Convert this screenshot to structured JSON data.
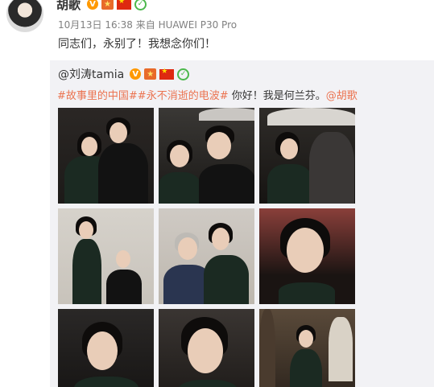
{
  "post": {
    "username": "胡歌",
    "meta": "10月13日 16:38 来自 HUAWEI P30 Pro",
    "text": "同志们，永别了！我想念你们！",
    "badge_v": "V",
    "badge_star": "★"
  },
  "repost": {
    "username": "@刘涛tamia",
    "badge_v": "V",
    "badge_star": "★",
    "hashtag_1": "#故事里的中国#",
    "hashtag_2": "#永不消逝的电波#",
    "body": " 你好！我是何兰芬。",
    "mention": "@胡歌",
    "images": [
      {
        "label": "photo-1"
      },
      {
        "label": "photo-2"
      },
      {
        "label": "photo-3"
      },
      {
        "label": "photo-4"
      },
      {
        "label": "photo-5"
      },
      {
        "label": "photo-6"
      },
      {
        "label": "photo-7"
      },
      {
        "label": "photo-8"
      },
      {
        "label": "photo-9"
      }
    ]
  },
  "colors": {
    "link": "#eb7350",
    "meta": "#808080",
    "repost_bg": "#f2f2f5",
    "verified_badge": "#ff9900"
  }
}
